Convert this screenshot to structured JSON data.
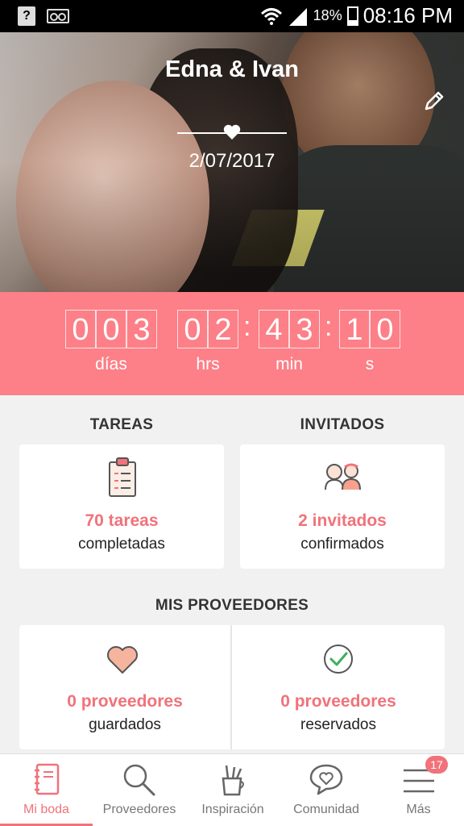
{
  "statusbar": {
    "help_icon": "?",
    "battery": "18%",
    "time": "08:16 PM"
  },
  "hero": {
    "couple": "Edna & Ivan",
    "date": "2/07/2017"
  },
  "countdown": {
    "days": [
      "0",
      "0",
      "3"
    ],
    "hours": [
      "0",
      "2"
    ],
    "minutes": [
      "4",
      "3"
    ],
    "seconds": [
      "1",
      "0"
    ],
    "sep": ":",
    "labels": {
      "days": "días",
      "hours": "hrs",
      "minutes": "min",
      "seconds": "s"
    }
  },
  "tasks": {
    "title": "TAREAS",
    "count": "70 tareas",
    "sub": "completadas"
  },
  "guests": {
    "title": "INVITADOS",
    "count": "2 invitados",
    "sub": "confirmados"
  },
  "vendors": {
    "title": "MIS PROVEEDORES",
    "saved": {
      "count": "0 proveedores",
      "sub": "guardados"
    },
    "booked": {
      "count": "0 proveedores",
      "sub": "reservados"
    }
  },
  "nav": {
    "items": [
      {
        "label": "Mi boda",
        "icon": "notebook-icon"
      },
      {
        "label": "Proveedores",
        "icon": "search-icon"
      },
      {
        "label": "Inspiración",
        "icon": "pencil-cup-icon"
      },
      {
        "label": "Comunidad",
        "icon": "chat-heart-icon"
      },
      {
        "label": "Más",
        "icon": "menu-icon"
      }
    ],
    "badge": "17"
  },
  "colors": {
    "accent": "#f1727a",
    "countdown_bg": "#fd7f87"
  }
}
